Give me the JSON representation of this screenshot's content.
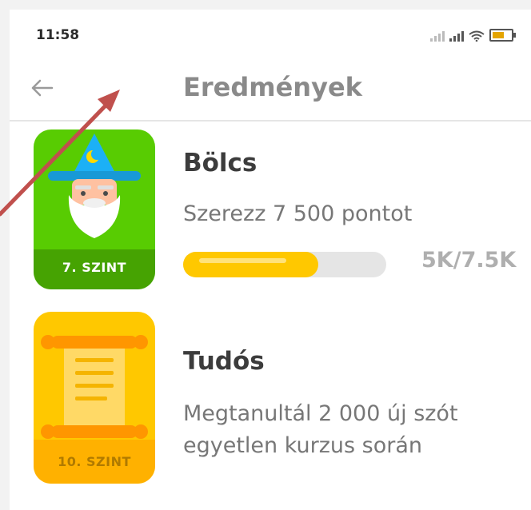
{
  "status_bar": {
    "time": "11:58",
    "icons": [
      "signal-weak-icon",
      "signal-icon",
      "wifi-icon",
      "battery-icon"
    ]
  },
  "header": {
    "title": "Eredmények",
    "back_icon": "arrow-left-icon"
  },
  "achievements": [
    {
      "title": "Bölcs",
      "description": "Szerezz 7 500 pontot",
      "level_label": "7. SZINT",
      "progress_text": "5K/7.5K",
      "progress_value": 0.667,
      "badge_color": "#58cc02",
      "badge_icon": "wizard-icon"
    },
    {
      "title": "Tudós",
      "description": "Megtanultál 2 000 új szót egyetlen kurzus során",
      "level_label": "10. SZINT",
      "badge_color": "#ffc800",
      "badge_icon": "scroll-icon"
    }
  ],
  "colors": {
    "progress_fill": "#ffc800",
    "progress_track": "#e5e5e5",
    "annotation_arrow": "#c0504d"
  }
}
